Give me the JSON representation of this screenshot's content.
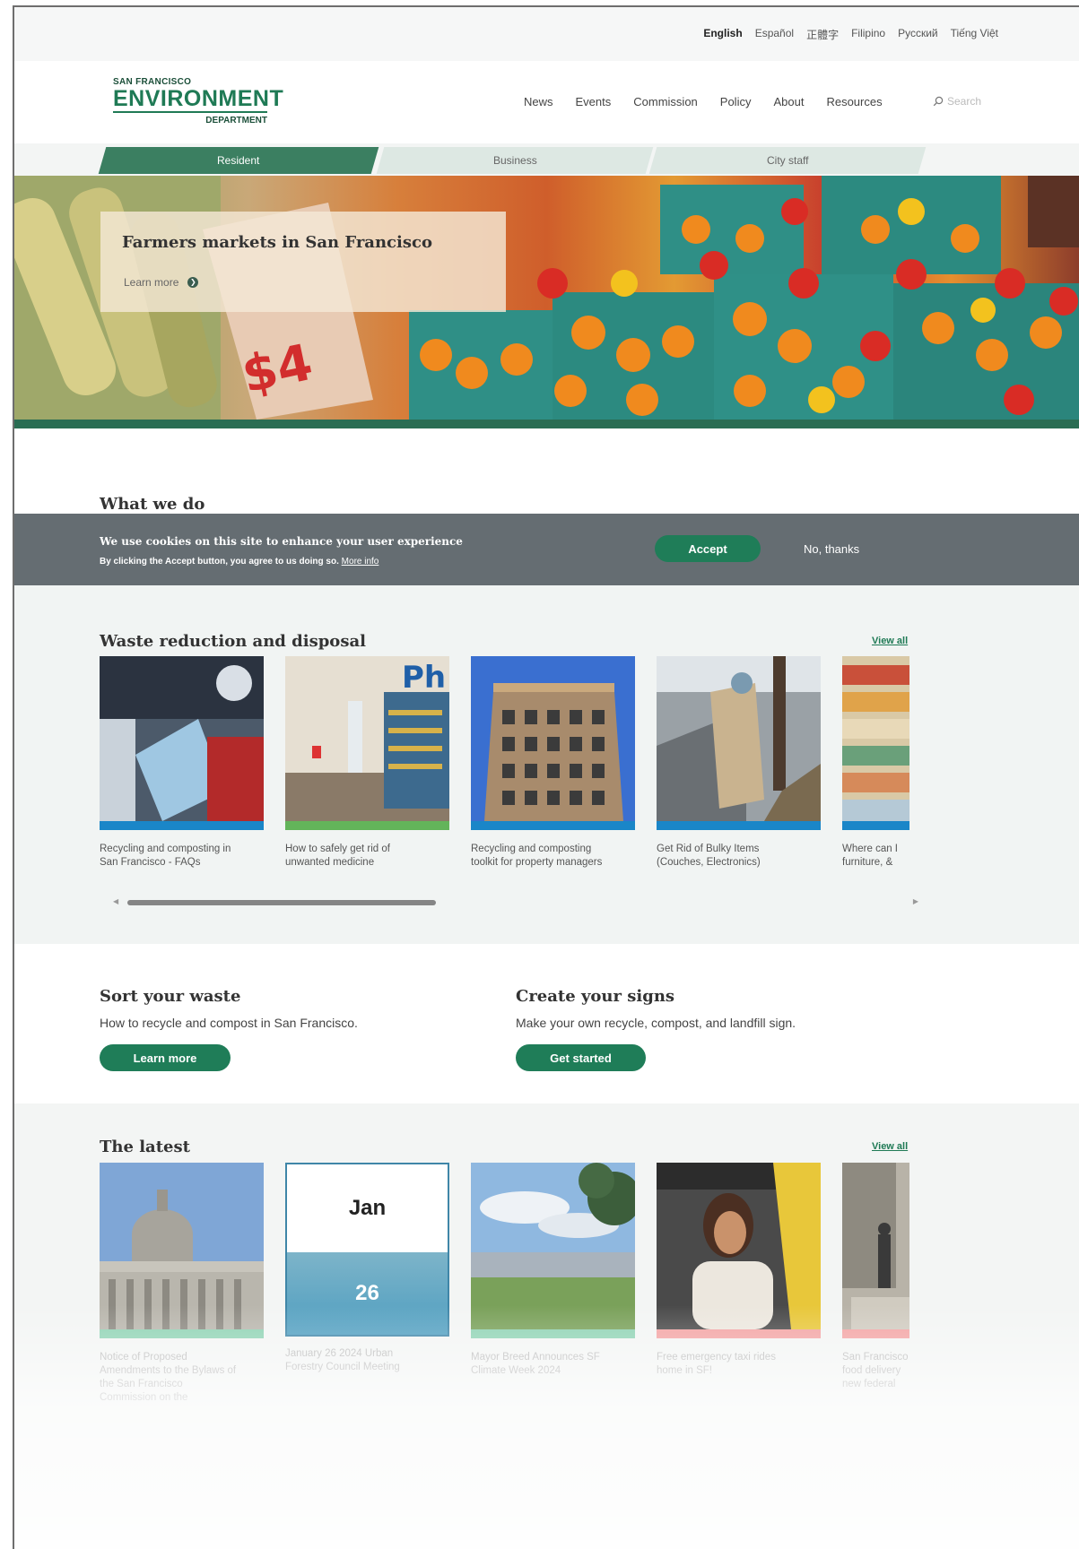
{
  "languages": [
    "English",
    "Español",
    "正體字",
    "Filipino",
    "Русский",
    "Tiếng Việt"
  ],
  "logo": {
    "line1": "SAN FRANCISCO",
    "line2": "ENVIRONMENT",
    "line3": "DEPARTMENT"
  },
  "nav": [
    "News",
    "Events",
    "Commission",
    "Policy",
    "About",
    "Resources"
  ],
  "search": {
    "placeholder": "Search"
  },
  "audience_tabs": [
    "Resident",
    "Business",
    "City staff"
  ],
  "hero": {
    "title": "Farmers markets in San Francisco",
    "link": "Learn more"
  },
  "what_we_do": {
    "title": "What we do"
  },
  "cookie": {
    "title": "We use cookies on this site to enhance your user experience",
    "text": "By clicking the Accept button, you agree to us doing so.",
    "link": "More info",
    "accept": "Accept",
    "decline": "No, thanks"
  },
  "waste": {
    "title": "Waste reduction and disposal",
    "view_all": "View all",
    "cards": [
      {
        "line1": "Recycling and composting in",
        "line2": "San Francisco - FAQs",
        "band": "#1a86c8"
      },
      {
        "line1": "How to safely get rid of",
        "line2": "unwanted medicine",
        "band": "#63b45a"
      },
      {
        "line1": "Recycling and composting",
        "line2": "toolkit for property managers",
        "band": "#1a86c8"
      },
      {
        "line1": "Get Rid of Bulky Items",
        "line2": "(Couches, Electronics)",
        "band": "#1a86c8"
      },
      {
        "line1": "Where can I",
        "line2": "furniture, &",
        "band": "#1a86c8"
      }
    ]
  },
  "sort": {
    "title": "Sort your waste",
    "text": "How to recycle and compost in San Francisco.",
    "button": "Learn more"
  },
  "signs": {
    "title": "Create your signs",
    "text": "Make your own recycle, compost, and landfill sign.",
    "button": "Get started"
  },
  "latest": {
    "title": "The latest",
    "view_all": "View all",
    "calendar": {
      "month": "Jan",
      "day": "26"
    },
    "cards": [
      {
        "lines": [
          "Notice of Proposed",
          "Amendments to the Bylaws of",
          "the San Francisco",
          "Commission on the"
        ],
        "band": "#8fd3b4"
      },
      {
        "lines": [
          "January 26 2024 Urban",
          "Forestry Council Meeting"
        ],
        "band": "#7fc3da"
      },
      {
        "lines": [
          "Mayor Breed Announces SF",
          "Climate Week 2024"
        ],
        "band": "#8fd3b4"
      },
      {
        "lines": [
          "Free emergency taxi rides",
          "home in SF!"
        ],
        "band": "#f3a3a3"
      },
      {
        "lines": [
          "San Francisco",
          "food delivery",
          "new federal"
        ],
        "band": "#f3a3a3"
      }
    ]
  }
}
